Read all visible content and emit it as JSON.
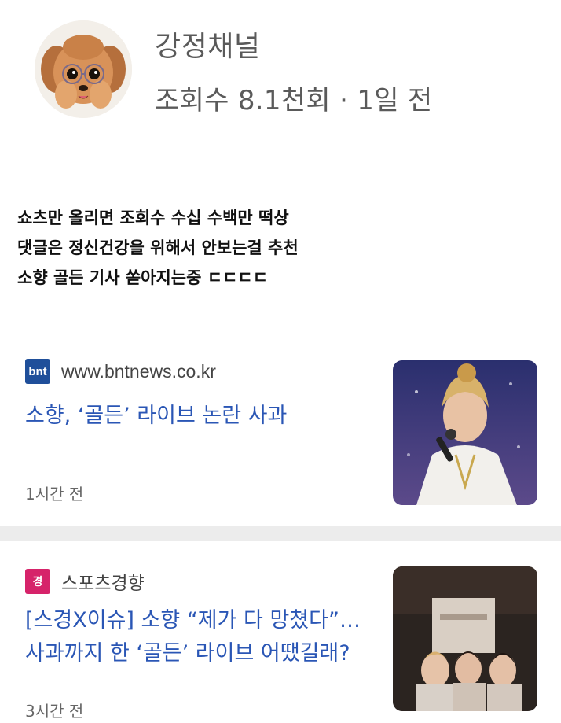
{
  "header": {
    "channel_name": "강정채널",
    "view_info": "조회수 8.1천회 · 1일 전"
  },
  "post": {
    "lines": [
      "쇼츠만 올리면 조회수 수십 수백만 떡상",
      "댓글은 정신건강을 위해서 안보는걸 추천",
      "소향 골든 기사 쏟아지는중 ㄷㄷㄷㄷ"
    ]
  },
  "news": [
    {
      "source_logo": "bnt",
      "source": "www.bntnews.co.kr",
      "headline": "소향, ‘골든’ 라이브 논란 사과",
      "time": "1시간 전"
    },
    {
      "source_logo": "경",
      "source": "스포츠경향",
      "headline": "[스경X이슈] 소향 “제가 다 망쳤다”…사과까지 한 ‘골든’ 라이브 어땠길래?",
      "time": "3시간 전"
    }
  ],
  "colors": {
    "headline": "#2a56b5",
    "bnt_logo": "#1f4f9a",
    "sk_logo": "#d6236a",
    "separator": "#ececec"
  },
  "icons": [
    "puppy-avatar-icon",
    "bnt-logo-icon",
    "sports-kyunghyang-logo-icon"
  ]
}
